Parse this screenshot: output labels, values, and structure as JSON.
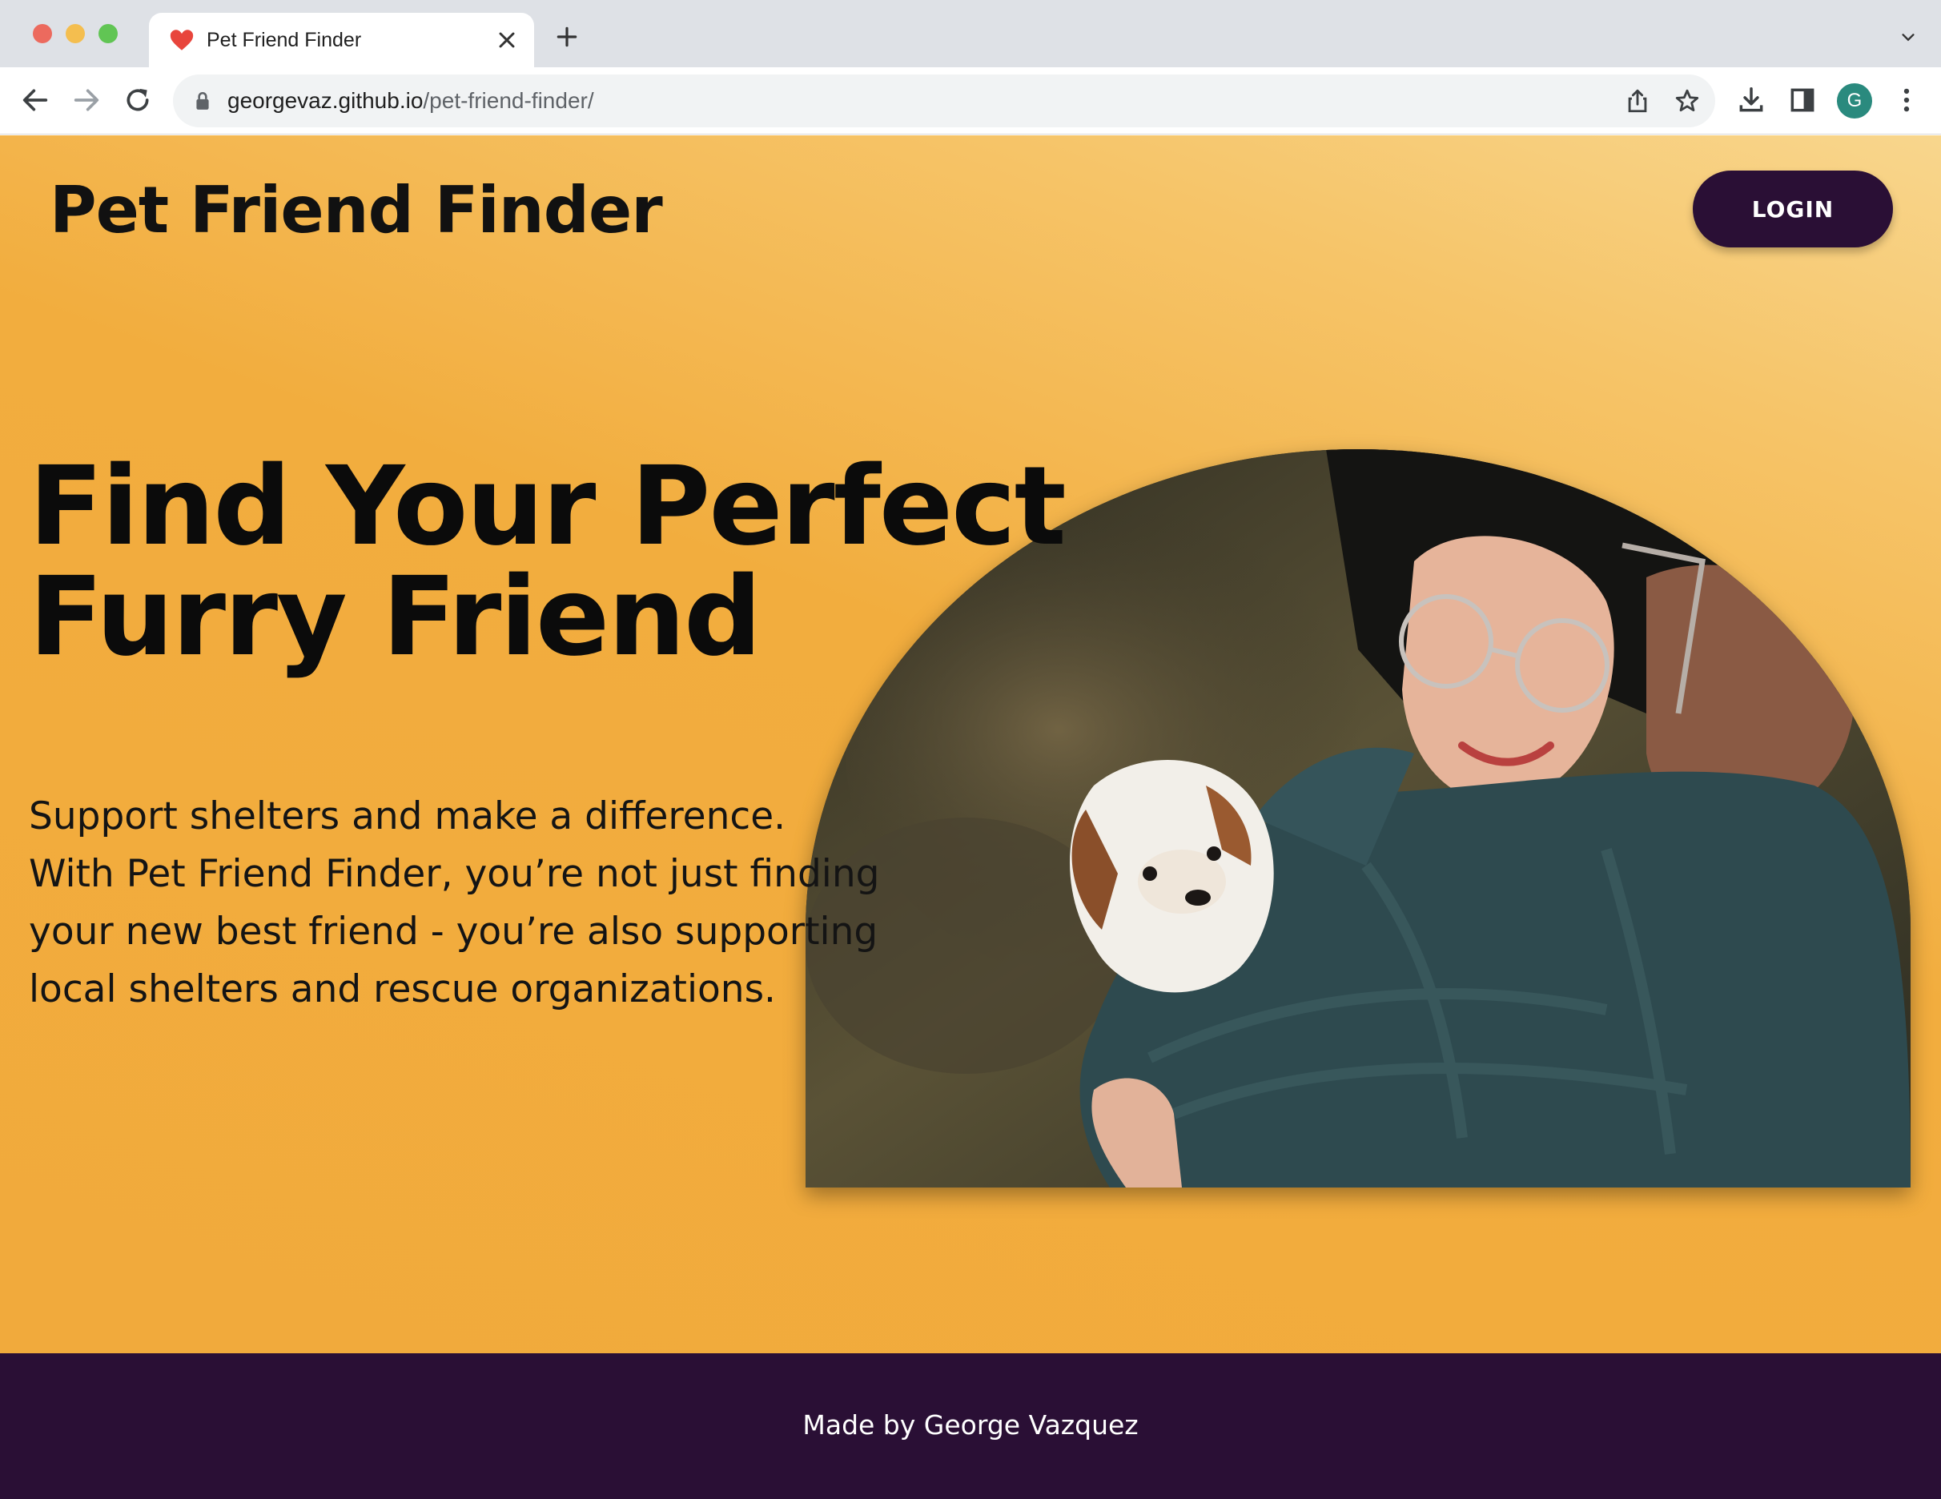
{
  "browser": {
    "tab_title": "Pet Friend Finder",
    "url_host": "georgevaz.github.io",
    "url_path": "/pet-friend-finder/",
    "avatar_letter": "G",
    "icons": [
      "heart-favicon-icon",
      "close-icon",
      "plus-icon",
      "chevron-down-icon",
      "back-arrow-icon",
      "forward-arrow-icon",
      "reload-icon",
      "lock-icon",
      "share-icon",
      "star-icon",
      "download-icon",
      "side-panel-icon",
      "more-vert-icon"
    ]
  },
  "header": {
    "brand": "Pet Friend Finder",
    "login_label": "LOGIN"
  },
  "hero": {
    "title_line1": "Find Your Perfect",
    "title_line2": "Furry Friend",
    "text_lines": [
      "Support shelters and make a difference.",
      "With Pet Friend Finder, you’re not just finding",
      "your new best friend - you’re also supporting",
      "local shelters and rescue organizations."
    ]
  },
  "footer": {
    "credit": "Made by George Vazquez"
  },
  "colors": {
    "page_gradient_light": "#f8d68d",
    "page_gradient_dark": "#f1aa3c",
    "primary_dark": "#2a0f35",
    "text": "#111111",
    "white": "#ffffff"
  }
}
